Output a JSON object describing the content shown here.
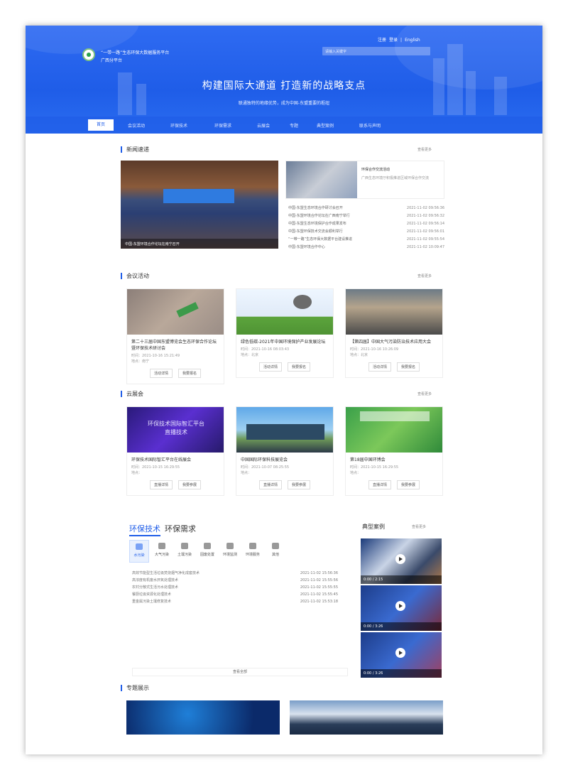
{
  "header": {
    "site_name_line1": "“一带一路”生态环保大数据服务平台",
    "site_name_line2": "广西分平台",
    "login": "登录",
    "register": "注册",
    "separator": "|",
    "english": "English",
    "search_placeholder": "请输入关键字",
    "slogan": "构建国际大通道   打造新的战略支点",
    "subslogan": "联通独特的地缘优势，成为中国-东盟重要的枢纽"
  },
  "nav": {
    "items": [
      "首页",
      "会议活动",
      "环保技术",
      "环保需求",
      "云展会",
      "专题",
      "典型案例",
      "联系与声明"
    ]
  },
  "news": {
    "title": "新闻速递",
    "more": "查看更多",
    "main_caption": "中国-东盟环境合作论坛在南宁召开",
    "side_title": "环保合作交流活动",
    "side_desc": "广西生态环境厅积极推进区域环保合作交流",
    "rows": [
      {
        "t": "中国-东盟生态环境合作研讨会召开",
        "d": "2021-11-02 09:56:36"
      },
      {
        "t": "中国-东盟环境合作论坛在广西南宁举行",
        "d": "2021-11-02 09:56:32"
      },
      {
        "t": "中国-东盟生态环境保护合作成果发布",
        "d": "2021-11-02 09:56:14"
      },
      {
        "t": "中国-东盟环保技术交流会顺利举行",
        "d": "2021-11-02 09:56:01"
      },
      {
        "t": "“一带一路”生态环保大数据平台建设推进",
        "d": "2021-11-02 09:55:54"
      },
      {
        "t": "中国-东盟环境合作中心",
        "d": "2021-11-02 10:09:47"
      }
    ]
  },
  "meetings": {
    "title": "会议活动",
    "more": "查看更多",
    "cards": [
      {
        "title": "第二十三届中国东盟博览会生态环保合作论坛暨环保技术研讨会",
        "time": "时间：2021-10-16 15:21:49",
        "place": "地点：南宁",
        "b1": "活动详情",
        "b2": "我要报名"
      },
      {
        "title": "绿色低碳-2021年中国环境保护产业发展论坛",
        "time": "时间：2021-10-16 08:03:43",
        "place": "地点：北京",
        "b1": "活动详情",
        "b2": "我要报名"
      },
      {
        "title": "【第四届】中国大气污染防治技术应用大会",
        "time": "时间：2021-10-16 10:26:09",
        "place": "地点：北京",
        "b1": "活动详情",
        "b2": "我要报名"
      }
    ]
  },
  "expo": {
    "title": "云展会",
    "more": "查看更多",
    "cards": [
      {
        "title": "环保技术国际智汇平台在线展会",
        "banner": "环保技术国际智汇平台",
        "banner2": "直播技术",
        "time": "时间：2021-10-15 16:29:55",
        "place": "地点：",
        "b1": "直播详情",
        "b2": "我要参展"
      },
      {
        "title": "中国国际环保科技展览会",
        "banner": "",
        "banner2": "",
        "time": "时间：2021-10-07 08:25:55",
        "place": "地点：",
        "b1": "直播详情",
        "b2": "我要参展"
      },
      {
        "title": "第18届中国环博会",
        "banner": "",
        "banner2": "",
        "time": "时间：2021-10-15 16:29:55",
        "place": "地点：",
        "b1": "直播详情",
        "b2": "我要参展"
      }
    ]
  },
  "tech": {
    "tab1": "环保技术",
    "tab2": "环保需求",
    "categories": [
      "水污染",
      "大气污染",
      "土壤污染",
      "固废处置",
      "环境监测",
      "环境服务",
      "其他"
    ],
    "rows": [
      {
        "t": "高效节能型生活垃圾焚烧烟气净化成套技术",
        "d": "2021-11-02 15:56:36"
      },
      {
        "t": "高浓度有机废水厌氧处理技术",
        "d": "2021-11-02 15:55:56"
      },
      {
        "t": "农村分散式生活污水处理技术",
        "d": "2021-11-02 15:55:55"
      },
      {
        "t": "餐厨垃圾资源化处理技术",
        "d": "2021-11-02 15:55:45"
      },
      {
        "t": "重金属污染土壤修复技术",
        "d": "2021-11-02 15:53:18"
      }
    ],
    "view_all": "查看全部"
  },
  "cases": {
    "title": "典型案例",
    "more": "查看更多",
    "videos": [
      {
        "time": "0:00 / 2:15"
      },
      {
        "time": "0:00 / 3:26"
      },
      {
        "time": "0:00 / 3:26"
      }
    ]
  },
  "special": {
    "title": "专题展示"
  },
  "colors": {
    "accent": "#1f5de8",
    "banner": "#2f6bf2"
  }
}
